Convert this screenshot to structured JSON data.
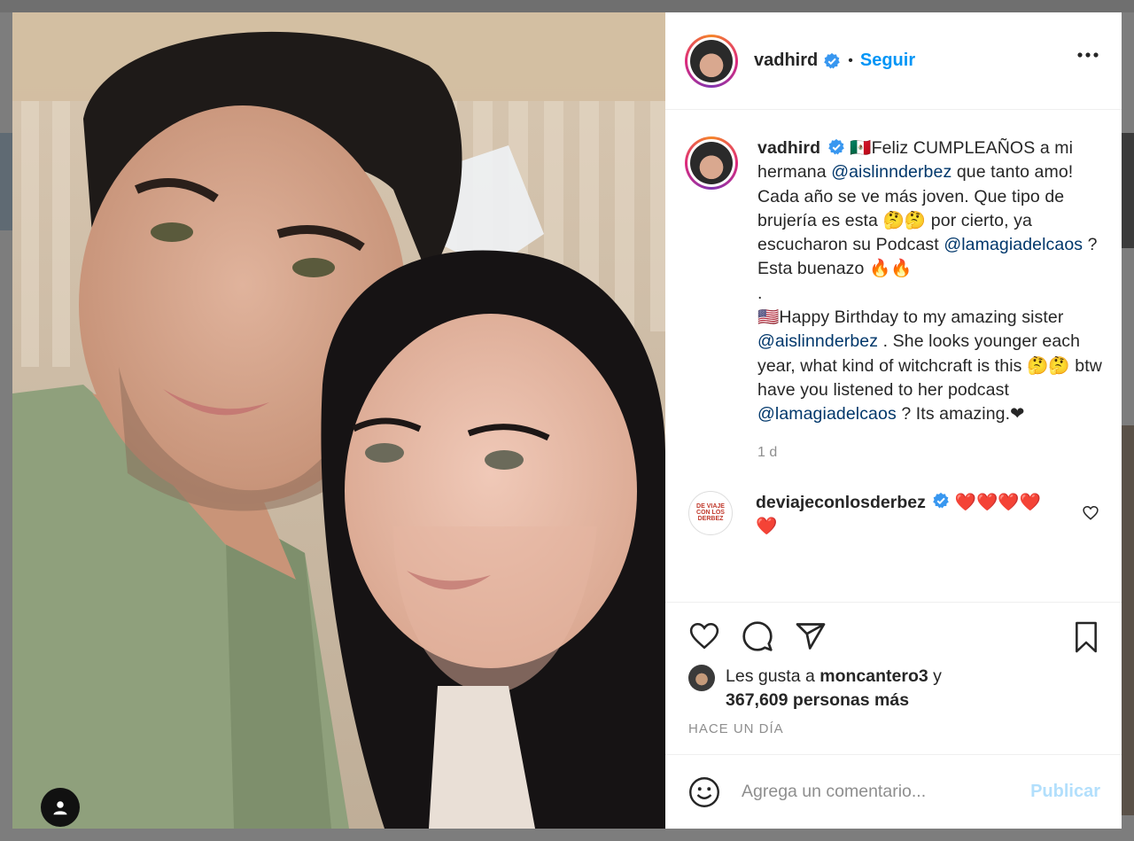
{
  "post": {
    "username": "vadhird",
    "follow_label": "Seguir",
    "separator": "•"
  },
  "caption": {
    "username": "vadhird",
    "flag_mx": "🇲🇽",
    "part1": "Feliz CUMPLEAÑOS a mi hermana ",
    "mention1": "@aislinnderbez",
    "part2": " que tanto amo! Cada año se ve más joven. Que tipo de brujería es esta 🤔🤔 por cierto, ya escucharon su Podcast ",
    "mention2": "@lamagiadelcaos",
    "part3": " ? Esta buenazo 🔥🔥",
    "dot_line": ".",
    "flag_us": "🇺🇸",
    "part4": "Happy Birthday to my amazing sister ",
    "mention3": "@aislinnderbez",
    "part5": " . She looks younger each year, what kind of witchcraft is this 🤔🤔 btw have you listened to her podcast ",
    "mention4": "@lamagiadelcaos",
    "part6": " ? Its amazing.❤",
    "time": "1 d"
  },
  "comment": {
    "username": "deviajeconlosderbez",
    "text": "❤️❤️❤️❤️❤️",
    "avatar_text": "DE VIAJE CON LOS DERBEZ"
  },
  "likes": {
    "prefix": "Les gusta a ",
    "user": "moncantero3",
    "middle": " y",
    "count": "367,609 personas más"
  },
  "time_ago": "HACE UN DÍA",
  "add_comment": {
    "placeholder": "Agrega un comentario...",
    "publish_label": "Publicar"
  },
  "icons": {
    "more": "more-options-icon",
    "like": "heart-icon",
    "comment": "comment-bubble-icon",
    "share": "paper-plane-icon",
    "save": "bookmark-icon",
    "emoji": "smiley-icon",
    "tag": "user-tag-icon",
    "verified": "verified-badge-icon"
  },
  "colors": {
    "accent": "#0095f6",
    "mention": "#00376b",
    "muted": "#8e8e8e",
    "publish_disabled": "#b2dffc",
    "verified": "#3897f0"
  }
}
